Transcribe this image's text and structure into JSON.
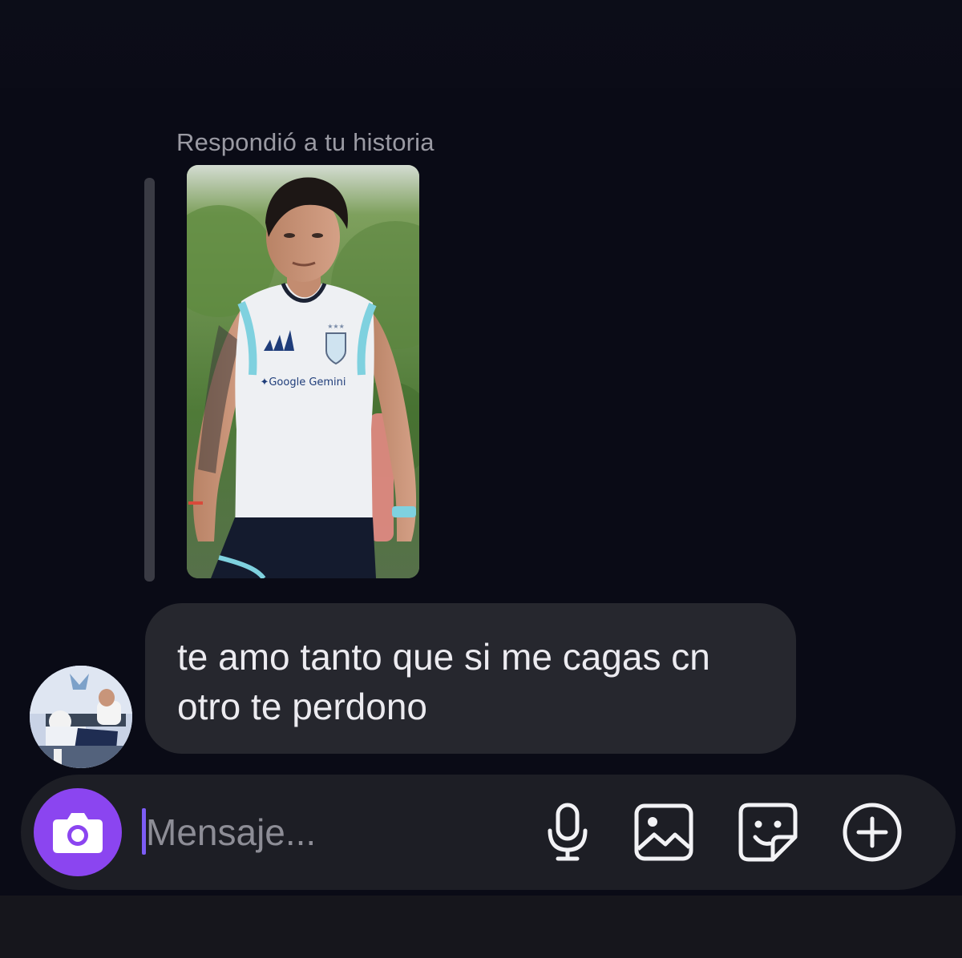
{
  "conversation": {
    "reply_label": "Respondió a tu historia",
    "story": {
      "shirt_sponsor": "Google Gemini"
    },
    "message": {
      "line1": "te amo tanto que si me cagas cn",
      "line2": "otro te perdono"
    }
  },
  "composer": {
    "placeholder": "Mensaje...",
    "icons": [
      "camera-icon",
      "microphone-icon",
      "gallery-icon",
      "sticker-icon",
      "plus-icon"
    ]
  },
  "colors": {
    "background": "#0a0b16",
    "bubble": "#26272e",
    "composer": "#1d1e25",
    "camera_button": "#8b45f0",
    "caret": "#7c5cf5"
  }
}
